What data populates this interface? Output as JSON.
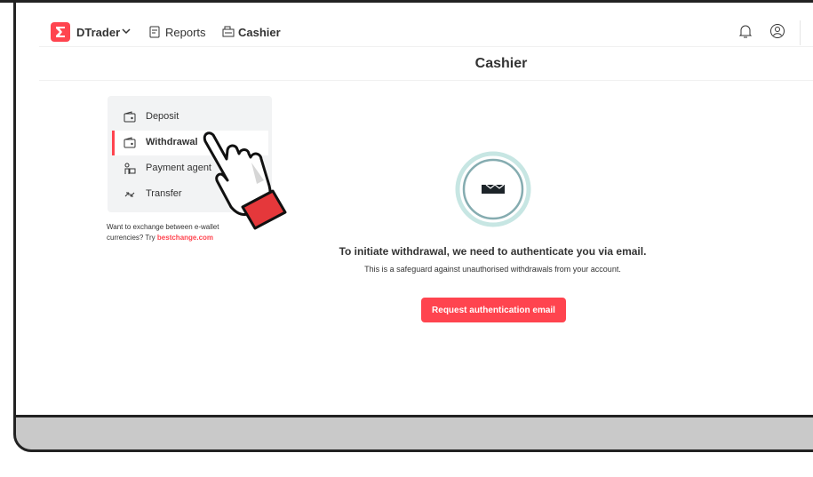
{
  "header": {
    "brand_label": "DTrader",
    "nav_reports": "Reports",
    "nav_cashier": "Cashier"
  },
  "page": {
    "title": "Cashier"
  },
  "side_menu": {
    "items": [
      {
        "label": "Deposit",
        "icon": "wallet-icon"
      },
      {
        "label": "Withdrawal",
        "icon": "withdraw-wallet-icon"
      },
      {
        "label": "Payment agent",
        "icon": "payment-agent-icon"
      },
      {
        "label": "Transfer",
        "icon": "transfer-icon"
      }
    ],
    "active_index": 1
  },
  "exchange_note": {
    "text": "Want to exchange between e-wallet currencies? Try ",
    "link": "bestchange.com"
  },
  "main": {
    "heading": "To initiate withdrawal, we need to authenticate you via email.",
    "subtext": "This is a safeguard against unauthorised withdrawals from your account.",
    "button_label": "Request authentication email"
  },
  "colors": {
    "accent": "#ff444f",
    "lock_ring": "#c7e6e3",
    "lock_ring_inner": "#85acb0",
    "hand_cuff": "#e5383b"
  }
}
